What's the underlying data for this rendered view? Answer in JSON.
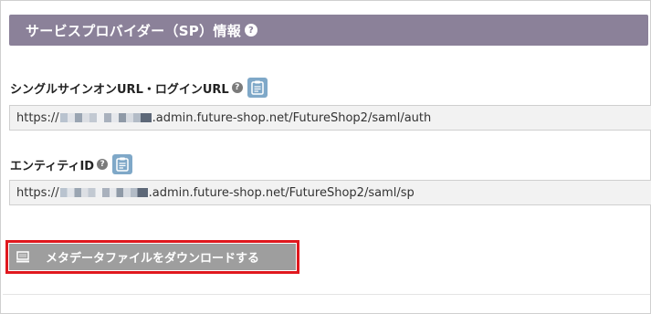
{
  "section": {
    "title": "サービスプロバイダー（SP）情報",
    "help_glyph": "?"
  },
  "fields": [
    {
      "label": "シングルサインオンURL・ログインURL",
      "help_glyph": "?",
      "value_prefix": "https://",
      "value_suffix": ".admin.future-shop.net/FutureShop2/saml/auth"
    },
    {
      "label": "エンティティID",
      "help_glyph": "?",
      "value_prefix": "https://",
      "value_suffix": ".admin.future-shop.net/FutureShop2/saml/sp"
    }
  ],
  "download": {
    "label": "メタデータファイルをダウンロードする",
    "icon": "monitor-icon"
  },
  "colors": {
    "header_bg": "#8b8199",
    "copy_button": "#7fa8c8",
    "download_button": "#9e9e9e",
    "highlight_outline": "#e0181e"
  }
}
